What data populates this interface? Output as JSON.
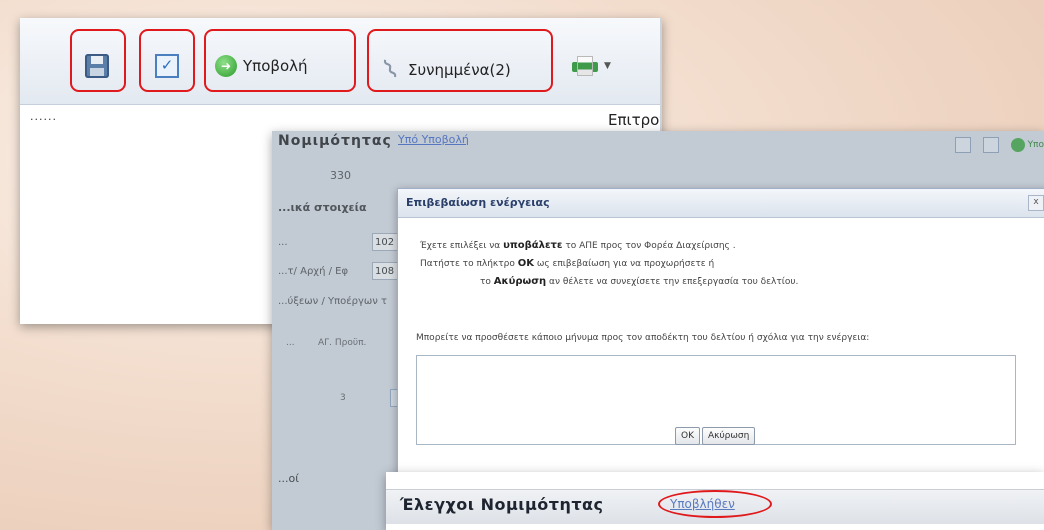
{
  "shot1": {
    "toolbar": {
      "submit_label": "Υποβολή",
      "attachments_label": "Συνημμένα",
      "attachments_count": "(2)"
    },
    "left_text": "......",
    "right_text": "Επιτροπή Αγαλήψεων Έργων (ΑΕΦ)"
  },
  "shot2": {
    "form": {
      "title": "Νομιμότητας",
      "status_link": "Υπό Υποβολή",
      "number": "330",
      "section_label": "...ικά στοιχεία",
      "field1_label": "...",
      "field1_value": "102",
      "field2_label": "...τ/ Αρχή / Εφ",
      "field2_value": "108",
      "field3_label": "...ύξεων / Υποέργων τ",
      "col1": "...",
      "col2": "ΑΓ. Προϋπ.",
      "row_value": "3",
      "bottom_label": "...οί",
      "side_label": "Υπο"
    },
    "dialog": {
      "title": "Επιβεβαίωση ενέργειας",
      "close": "x",
      "line1_a": "Έχετε επιλέξει να ",
      "line1_b": "υποβάλετε",
      "line1_c": " το ΑΠΕ προς τον Φορέα Διαχείρισης .",
      "line2_a": "Πατήστε το πλήκτρο ",
      "line2_b": "ΟΚ",
      "line2_c": " ως επιβεβαίωση για να προχωρήσετε ή",
      "line3_a": "το ",
      "line3_b": "Ακύρωση",
      "line3_c": " αν θέλετε να συνεχίσετε την επεξεργασία του δελτίου.",
      "prompt": "Μπορείτε να προσθέσετε κάποιο μήνυμα προς τον αποδέκτη του δελτίου ή σχόλια για την ενέργεια:",
      "message": "",
      "ok_label": "OK",
      "cancel_label": "Ακύρωση"
    }
  },
  "shot3": {
    "title": "Έλεγχοι Νομιμότητας",
    "status_link": "Υποβλήθεν"
  }
}
